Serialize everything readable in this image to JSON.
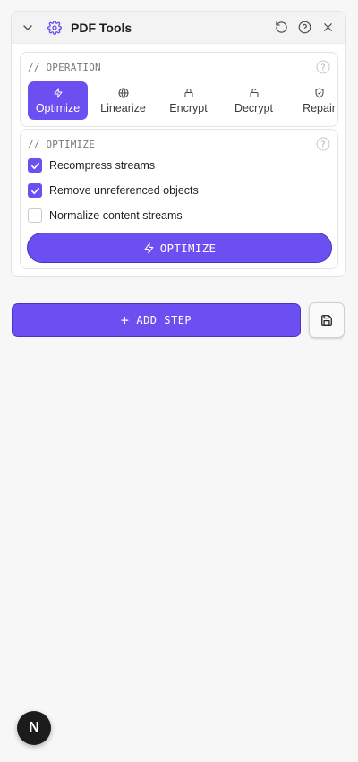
{
  "tool": {
    "title": "PDF Tools",
    "icons": {
      "collapse": "chevron-down-icon",
      "app": "gear-icon",
      "reset": "undo-icon",
      "help": "help-circle-icon",
      "close": "close-icon"
    }
  },
  "operation": {
    "label": "// OPERATION",
    "options": [
      {
        "label": "Optimize",
        "icon": "lightning-icon",
        "active": true
      },
      {
        "label": "Linearize",
        "icon": "globe-icon",
        "active": false
      },
      {
        "label": "Encrypt",
        "icon": "lock-icon",
        "active": false
      },
      {
        "label": "Decrypt",
        "icon": "unlock-icon",
        "active": false
      },
      {
        "label": "Repair",
        "icon": "shield-icon",
        "active": false
      }
    ]
  },
  "optimize": {
    "label": "// OPTIMIZE",
    "checks": [
      {
        "label": "Recompress streams",
        "checked": true
      },
      {
        "label": "Remove unreferenced objects",
        "checked": true
      },
      {
        "label": "Normalize content streams",
        "checked": false
      }
    ],
    "button_label": "OPTIMIZE"
  },
  "actions": {
    "add_step_label": "ADD STEP",
    "save_icon": "save-icon"
  },
  "badge": {
    "letter": "N"
  },
  "colors": {
    "accent": "#6b4ff0",
    "accent_border": "#4a31c4"
  }
}
